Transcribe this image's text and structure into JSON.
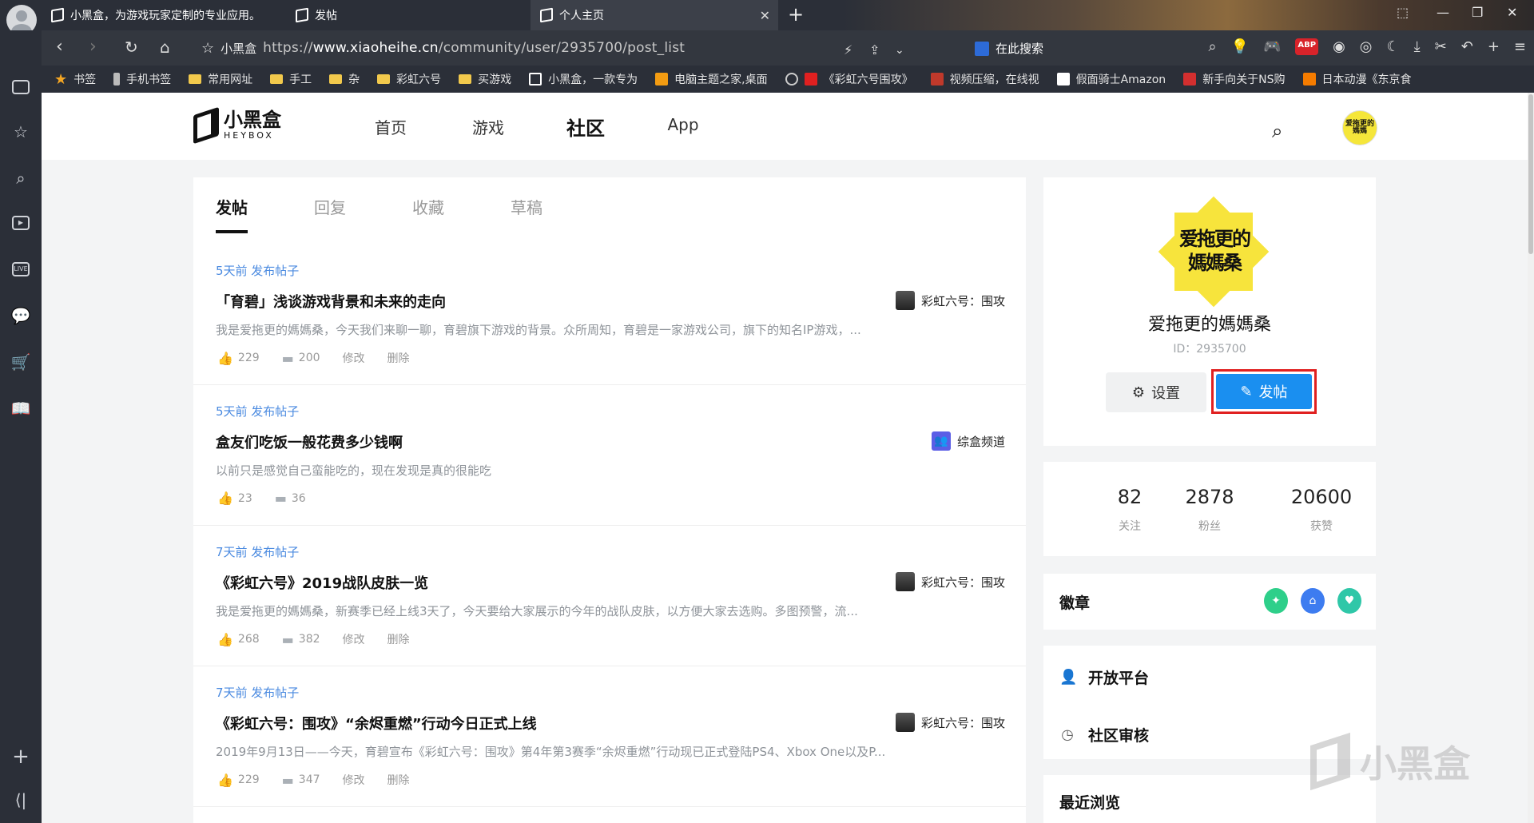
{
  "browser": {
    "tabs": [
      {
        "title": "小黑盒，为游戏玩家定制的专业应用。"
      },
      {
        "title": "发帖"
      },
      {
        "title": "个人主页"
      }
    ],
    "address": {
      "site_label": "小黑盒",
      "url_prefix": "https://",
      "url_domain": "www.xiaoheihe.cn",
      "url_path": "/community/user/2935700/post_list"
    },
    "search_engine_label": "在此搜索",
    "bookmarks": [
      {
        "label": "书签",
        "icon": "star"
      },
      {
        "label": "手机书签",
        "icon": "phone"
      },
      {
        "label": "常用网址",
        "icon": "folder"
      },
      {
        "label": "手工",
        "icon": "folder"
      },
      {
        "label": "杂",
        "icon": "folder"
      },
      {
        "label": "彩虹六号",
        "icon": "folder"
      },
      {
        "label": "买游戏",
        "icon": "folder"
      },
      {
        "label": "小黑盒，一款专为",
        "icon": "heybox"
      },
      {
        "label": "电脑主题之家,桌面",
        "icon": "site"
      },
      {
        "label": "《彩虹六号围攻》",
        "icon": "site"
      },
      {
        "label": "视频压缩，在线视",
        "icon": "site"
      },
      {
        "label": "假面骑士Amazon",
        "icon": "site"
      },
      {
        "label": "新手向关于NS购",
        "icon": "site"
      },
      {
        "label": "日本动漫《东京食",
        "icon": "site"
      }
    ]
  },
  "header": {
    "logo_cn": "小黑盒",
    "logo_en": "HEYBOX",
    "nav": [
      {
        "label": "首页"
      },
      {
        "label": "游戏"
      },
      {
        "label": "社区"
      },
      {
        "label": "App"
      }
    ],
    "avatar_text": "爱拖更的媽媽"
  },
  "tabs": [
    {
      "label": "发帖"
    },
    {
      "label": "回复"
    },
    {
      "label": "收藏"
    },
    {
      "label": "草稿"
    }
  ],
  "posts": [
    {
      "meta": "5天前 发布帖子",
      "title": "「育碧」浅谈游戏背景和未来的走向",
      "excerpt": "我是爱拖更的媽媽桑，今天我们来聊一聊，育碧旗下游戏的背景。众所周知，育碧是一家游戏公司，旗下的知名IP游戏，...",
      "likes": "229",
      "comments": "200",
      "edit": "修改",
      "delete": "删除",
      "topic": "彩虹六号：围攻"
    },
    {
      "meta": "5天前 发布帖子",
      "title": "盒友们吃饭一般花费多少钱啊",
      "excerpt": "以前只是感觉自己蛮能吃的，现在发现是真的很能吃",
      "likes": "23",
      "comments": "36",
      "topic": "综盒频道"
    },
    {
      "meta": "7天前 发布帖子",
      "title": "《彩虹六号》2019战队皮肤一览",
      "excerpt": "我是爱拖更的媽媽桑，新赛季已经上线3天了，今天要给大家展示的今年的战队皮肤，以方便大家去选购。多图预警，流...",
      "likes": "268",
      "comments": "382",
      "edit": "修改",
      "delete": "删除",
      "topic": "彩虹六号：围攻"
    },
    {
      "meta": "7天前 发布帖子",
      "title": "《彩虹六号：围攻》“余烬重燃”行动今日正式上线",
      "excerpt": "2019年9月13日——今天，育碧宣布《彩虹六号：围攻》第4年第3赛季“余烬重燃”行动现已正式登陆PS4、Xbox One以及P...",
      "likes": "229",
      "comments": "347",
      "edit": "修改",
      "delete": "删除",
      "topic": "彩虹六号：围攻"
    }
  ],
  "profile": {
    "avatar_text": "爱拖更的媽媽桑",
    "name": "爱拖更的媽媽桑",
    "id": "ID：2935700",
    "settings_label": "设置",
    "post_label": "发帖"
  },
  "stats": [
    {
      "value": "82",
      "label": "关注"
    },
    {
      "value": "2878",
      "label": "粉丝"
    },
    {
      "value": "20600",
      "label": "获赞"
    }
  ],
  "badges": {
    "title": "徽章",
    "items": [
      {
        "color": "#2ecf8a"
      },
      {
        "color": "#3d7cf0"
      },
      {
        "color": "#2fc7a8"
      }
    ]
  },
  "links": [
    {
      "label": "开放平台"
    },
    {
      "label": "社区审核"
    }
  ],
  "recent_title": "最近浏览",
  "watermark_text": "小黑盒"
}
